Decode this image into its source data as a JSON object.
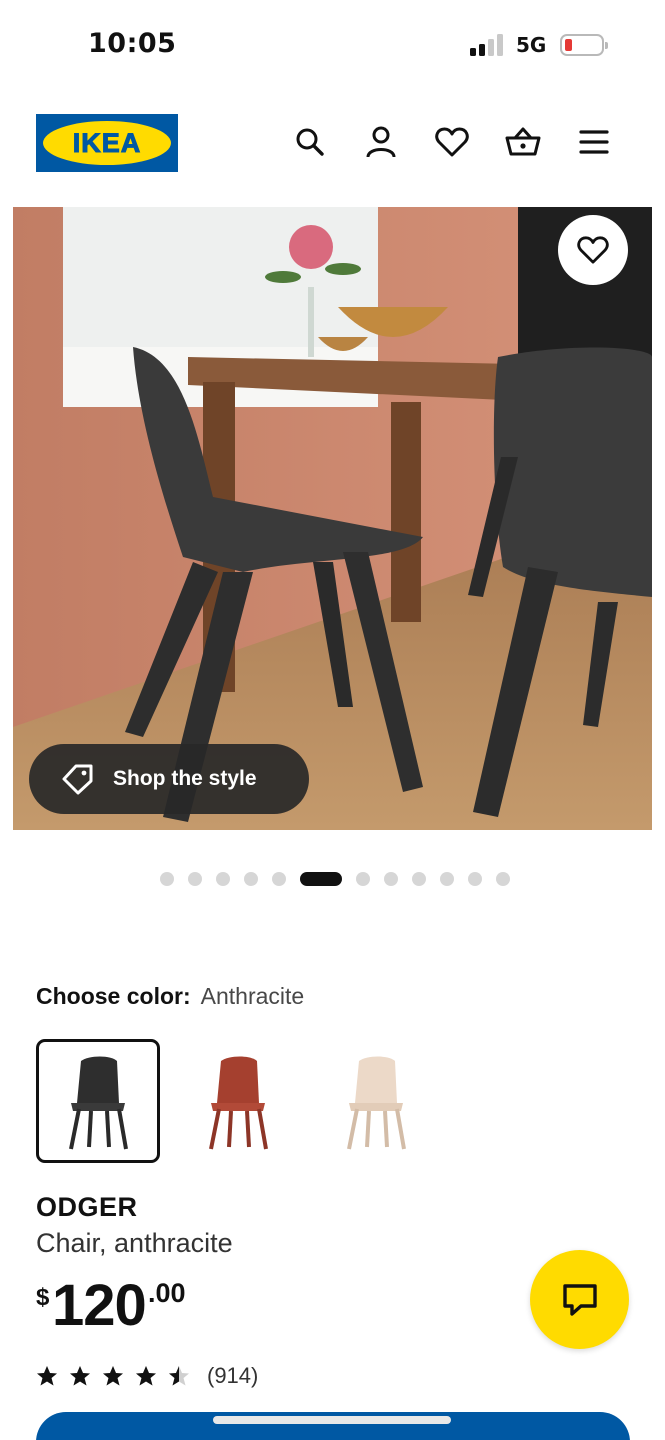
{
  "status_bar": {
    "time": "10:05",
    "network": "5G",
    "battery_level": 0.12,
    "battery_color": "#e53935",
    "signal_bars": 2
  },
  "header": {
    "logo_text": "IKEA",
    "brand_blue": "#0058a3",
    "brand_yellow": "#ffdb00",
    "icons": [
      "search-icon",
      "account-icon",
      "heart-icon",
      "basket-icon",
      "menu-icon"
    ]
  },
  "gallery": {
    "shop_the_style_label": "Shop the style",
    "slide_count": 12,
    "active_slide": 6
  },
  "color_chooser": {
    "label": "Choose color:",
    "selected_value": "Anthracite",
    "swatches": [
      {
        "name": "anthracite",
        "color": "#2e2e2e"
      },
      {
        "name": "red",
        "color": "#9c3a2e"
      },
      {
        "name": "beige",
        "color": "#e8d4c2"
      }
    ]
  },
  "product": {
    "name": "ODGER",
    "description": "Chair, anthracite",
    "price_currency": "$",
    "price_integer": "120",
    "price_decimal": ".00",
    "rating": 4.5,
    "review_count": "(914)"
  }
}
